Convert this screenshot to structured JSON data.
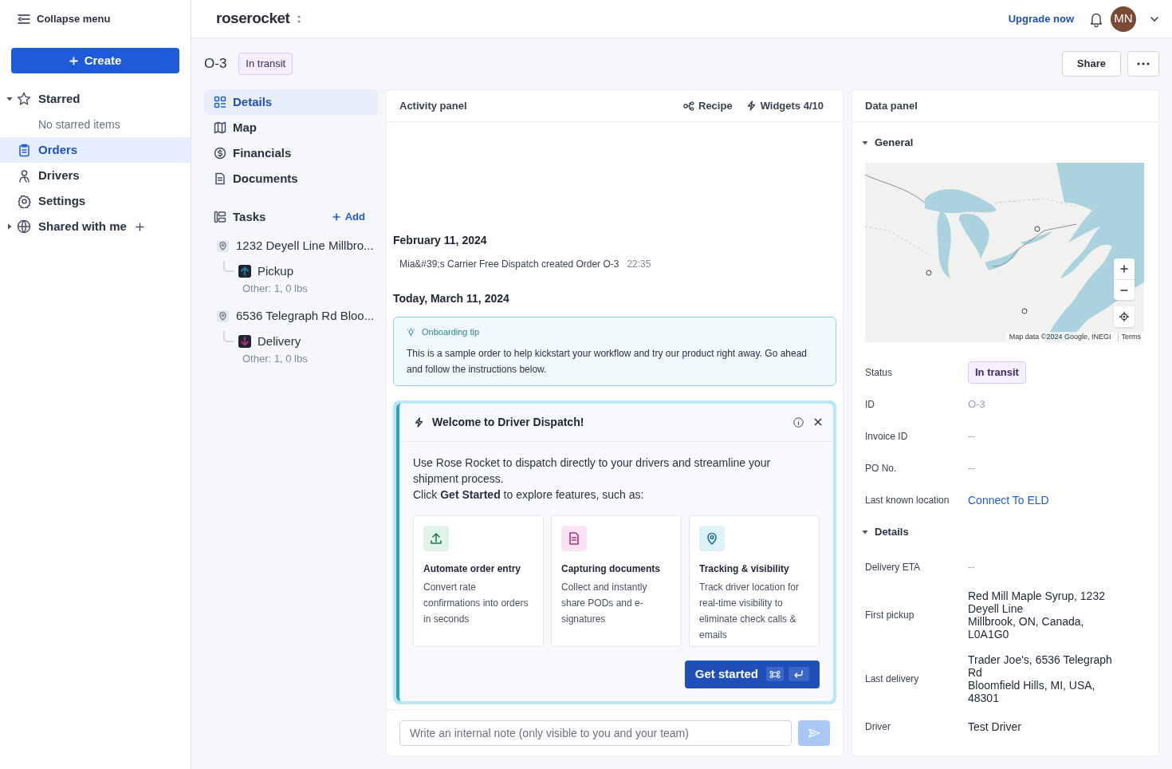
{
  "sidebar": {
    "collapse_label": "Collapse menu",
    "create_label": "Create",
    "items": [
      {
        "kind": "group",
        "label": "Starred",
        "expanded": true,
        "empty_text": "No starred items"
      },
      {
        "kind": "link",
        "label": "Orders",
        "selected": true
      },
      {
        "kind": "link",
        "label": "Drivers",
        "selected": false
      },
      {
        "kind": "link",
        "label": "Settings",
        "selected": false
      },
      {
        "kind": "group",
        "label": "Shared with me",
        "expanded": false
      }
    ]
  },
  "header": {
    "logo": "roserocket",
    "upgrade": "Upgrade now",
    "avatar": "MN"
  },
  "order": {
    "id": "O-3",
    "status": "In transit",
    "share": "Share"
  },
  "nav": {
    "items": [
      {
        "label": "Details",
        "selected": true
      },
      {
        "label": "Map",
        "selected": false
      },
      {
        "label": "Financials",
        "selected": false
      },
      {
        "label": "Documents",
        "selected": false
      }
    ],
    "tasks_label": "Tasks",
    "add_label": "Add",
    "stops": [
      {
        "address": "1232 Deyell Line Millbro...",
        "kind": "pickup",
        "type_label": "Pickup",
        "summary": "Other: 1, 0 lbs"
      },
      {
        "address": "6536 Telegraph Rd Bloo...",
        "kind": "delivery",
        "type_label": "Delivery",
        "summary": "Other: 1, 0 lbs"
      }
    ]
  },
  "activity": {
    "title": "Activity panel",
    "recipe": "Recipe",
    "widgets": "Widgets 4/10",
    "days": [
      {
        "date": "February 11, 2024",
        "events": [
          {
            "text": "Mia&#39;s Carrier Free Dispatch created Order O-3",
            "time": "22:35"
          }
        ]
      },
      {
        "date": "Today, March 11, 2024"
      }
    ],
    "tip": {
      "label": "Onboarding tip",
      "text": "This is a sample order to help kickstart your workflow and try our product right away. Go ahead and follow the instructions below."
    },
    "welcome": {
      "title": "Welcome to Driver Dispatch!",
      "intro": "Use Rose Rocket to dispatch directly to your drivers and streamline your shipment process.",
      "prompt": "Click **Get Started** to explore features, such as:",
      "features": [
        {
          "kind": "upload",
          "title": "Automate order entry",
          "text": "Convert rate confirmations into orders in seconds"
        },
        {
          "kind": "document",
          "title": "Capturing documents",
          "text": "Collect and instantly share PODs and e-signatures"
        },
        {
          "kind": "pin",
          "title": "Tracking & visibility",
          "text": "Track driver location for real-time visibility to eliminate check calls & emails"
        }
      ],
      "button": "Get started"
    },
    "note_placeholder": "Write an internal note (only visible to you and your team)"
  },
  "data_panel": {
    "title": "Data panel",
    "sections": [
      {
        "label": "General",
        "expanded": true,
        "map": {
          "attribution": "Map data ©2024 Google, INEGI",
          "terms": "Terms"
        },
        "rows": [
          {
            "label": "Status",
            "value": "In transit",
            "kind": "badge"
          },
          {
            "label": "ID",
            "value": "O-3",
            "kind": "muted"
          },
          {
            "label": "Invoice ID",
            "value": "--",
            "kind": "muted"
          },
          {
            "label": "PO No.",
            "value": "--",
            "kind": "muted"
          },
          {
            "label": "Last known location",
            "value": "Connect To ELD",
            "kind": "link"
          }
        ]
      },
      {
        "label": "Details",
        "expanded": true,
        "rows": [
          {
            "label": "Delivery ETA",
            "value": "--",
            "kind": "muted"
          },
          {
            "label": "First pickup",
            "value": "Red Mill Maple Syrup, 1232 Deyell Line\nMillbrook, ON, Canada, L0A1G0",
            "kind": "text"
          },
          {
            "label": "Last delivery",
            "value": "Trader Joe's, 6536 Telegraph Rd\nBloomfield Hills, MI, USA, 48301",
            "kind": "text"
          },
          {
            "label": "Driver",
            "value": "Test Driver",
            "kind": "text"
          }
        ]
      }
    ]
  }
}
